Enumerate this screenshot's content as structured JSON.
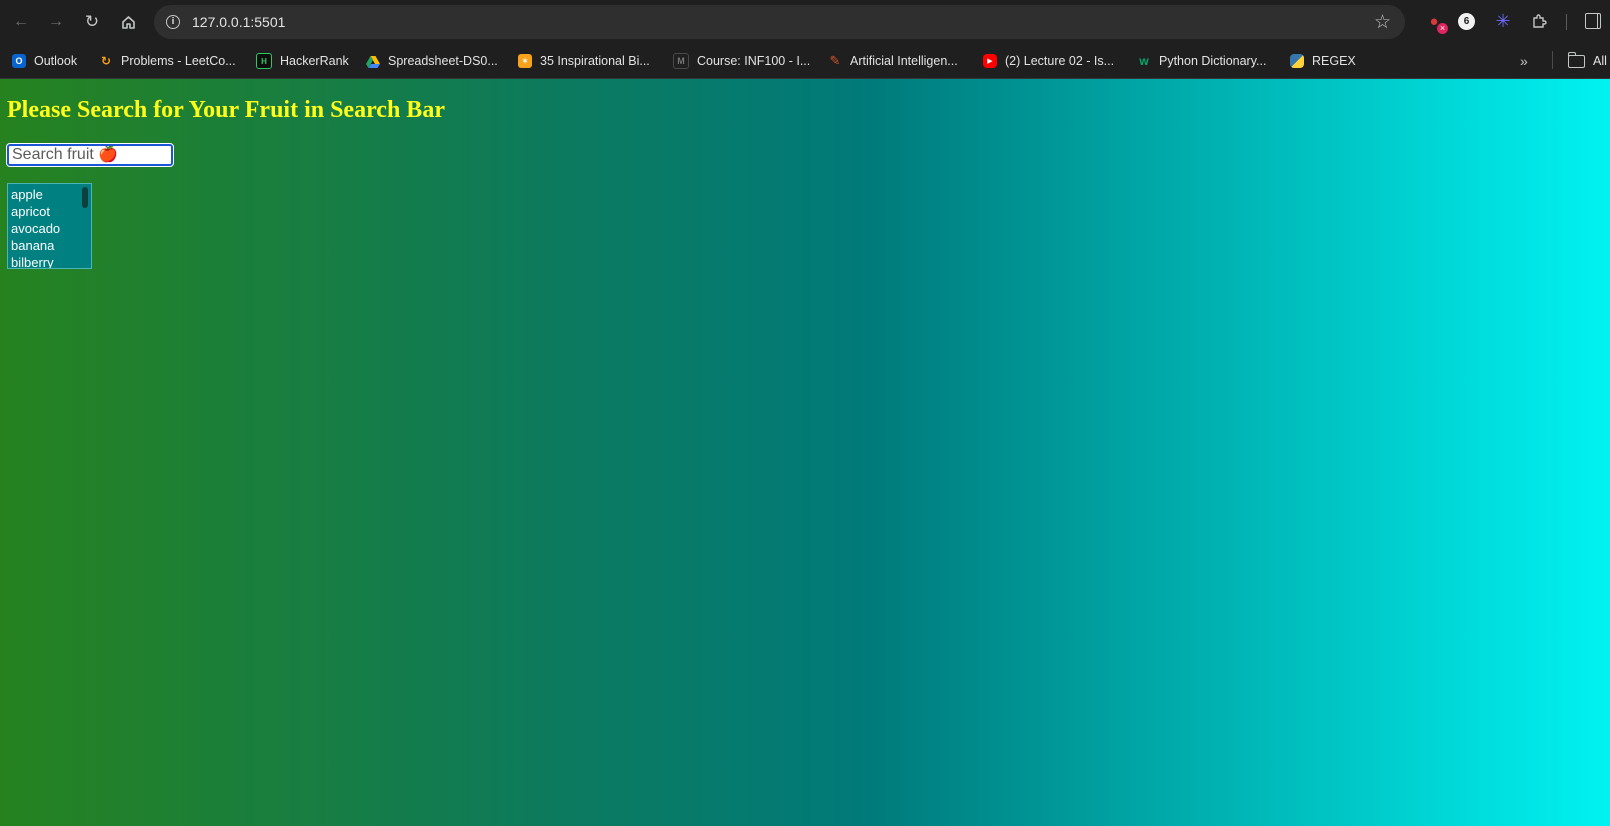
{
  "browser": {
    "url": "127.0.0.1:5501",
    "bookmarks": [
      {
        "label": "Outlook",
        "icon": "outlook-icon",
        "color": "#0a64d0"
      },
      {
        "label": "Problems - LeetCo...",
        "icon": "leetcode-icon",
        "color": "#f89f1b"
      },
      {
        "label": "HackerRank",
        "icon": "hackerrank-icon",
        "color": "#000000"
      },
      {
        "label": "Spreadsheet-DS0...",
        "icon": "google-drive-icon",
        "color": "#1fa463"
      },
      {
        "label": "35 Inspirational Bi...",
        "icon": "star-burst-icon",
        "color": "#f6a21a"
      },
      {
        "label": "Course: INF100 - I...",
        "icon": "course-icon",
        "color": "#3a3a3a"
      },
      {
        "label": "Artificial Intelligen...",
        "icon": "ai-icon",
        "color": "#d9552a"
      },
      {
        "label": "(2) Lecture 02 - Is...",
        "icon": "youtube-icon",
        "color": "#ff0000"
      },
      {
        "label": "Python Dictionary...",
        "icon": "w3schools-icon",
        "color": "#04aa6d"
      },
      {
        "label": "REGEX",
        "icon": "python-icon",
        "color": "#3776ab"
      }
    ],
    "all_bookmarks_label": "All"
  },
  "page": {
    "title": "Please Search for Your Fruit in Search Bar",
    "search_placeholder": "Search fruit 🍎",
    "fruits": [
      "apple",
      "apricot",
      "avocado",
      "banana",
      "bilberry"
    ]
  },
  "colors": {
    "title": "#ffff1a",
    "list_background": "#008080",
    "gradient_start": "#26821f",
    "gradient_end": "#00f2f2"
  }
}
